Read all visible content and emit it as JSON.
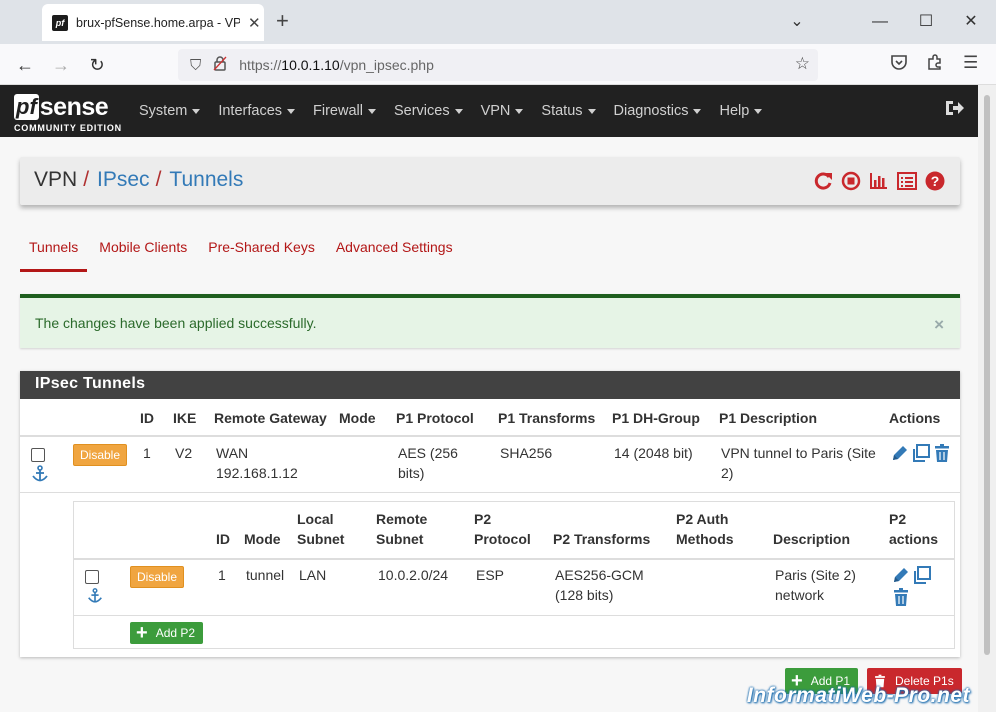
{
  "browser": {
    "tab_title": "brux-pfSense.home.arpa - VPN",
    "favicon": "pf",
    "url_proto": "https://",
    "url_host": "10.0.1.10",
    "url_path": "/vpn_ipsec.php"
  },
  "logo": {
    "pf": "pf",
    "sense": "sense",
    "edition": "COMMUNITY EDITION"
  },
  "menu": [
    "System",
    "Interfaces",
    "Firewall",
    "Services",
    "VPN",
    "Status",
    "Diagnostics",
    "Help"
  ],
  "breadcrumb": [
    "VPN",
    "IPsec",
    "Tunnels"
  ],
  "breadcrumb_sep": "/",
  "tabs": [
    "Tunnels",
    "Mobile Clients",
    "Pre-Shared Keys",
    "Advanced Settings"
  ],
  "alert": {
    "text": "The changes have been applied successfully.",
    "close": "×"
  },
  "panel": {
    "title": "IPsec Tunnels",
    "p1_headers": [
      "ID",
      "IKE",
      "Remote Gateway",
      "Mode",
      "P1 Protocol",
      "P1 Transforms",
      "P1 DH-Group",
      "P1 Description",
      "Actions"
    ],
    "p1_row": {
      "button": "Disable",
      "id": "1",
      "ike": "V2",
      "gateway_iface": "WAN",
      "gateway_ip": "192.168.1.12",
      "mode": "",
      "protocol_1": "AES (256",
      "protocol_2": "bits)",
      "transforms": "SHA256",
      "dh_group": "14 (2048 bit)",
      "description_1": "VPN tunnel to Paris (Site",
      "description_2": "2)"
    },
    "p2_headers": {
      "id": "ID",
      "mode": "Mode",
      "local_1": "Local",
      "local_2": "Subnet",
      "remote_1": "Remote",
      "remote_2": "Subnet",
      "proto_1": "P2",
      "proto_2": "Protocol",
      "transforms": "P2 Transforms",
      "auth_1": "P2 Auth",
      "auth_2": "Methods",
      "desc": "Description",
      "actions_1": "P2",
      "actions_2": "actions"
    },
    "p2_row": {
      "button": "Disable",
      "id": "1",
      "mode": "tunnel",
      "local": "LAN",
      "remote": "10.0.2.0/24",
      "protocol": "ESP",
      "transforms_1": "AES256-GCM",
      "transforms_2": "(128 bits)",
      "auth": "",
      "desc_1": "Paris (Site 2)",
      "desc_2": "network"
    },
    "add_p2": "Add P2"
  },
  "footer_buttons": {
    "add_p1": "Add P1",
    "delete_p1s": "Delete P1s"
  },
  "watermark": "InformatiWeb-Pro.net",
  "colors": {
    "brand_red": "#b31717",
    "link_blue": "#337ab7",
    "navbar": "#212121",
    "success_green": "#3c9c3c",
    "warning_orange": "#f0a540",
    "danger_red": "#c9282d"
  }
}
